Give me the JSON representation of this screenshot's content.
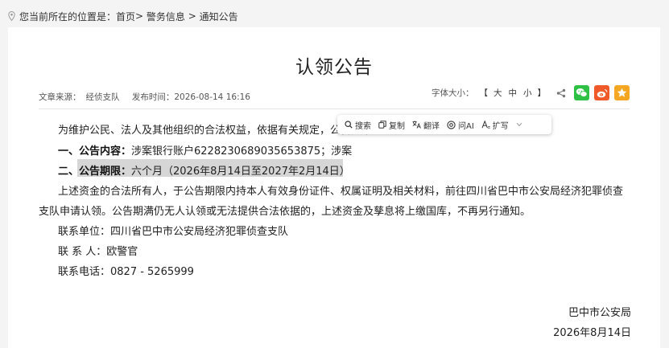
{
  "breadcrumb": {
    "prefix": "您当前所在的位置是：",
    "home": "首页",
    "sep1": "> ",
    "section": "警务信息",
    "sep2": " > ",
    "current": "通知公告"
  },
  "article": {
    "title": "认领公告",
    "source_label": "文章来源：",
    "source": "经侦支队",
    "time_label": "发布时间：",
    "time": "2026-08-14 16:16",
    "font_size_label": "字体大小：",
    "bracket_open": "【",
    "font_large": "大",
    "font_medium": "中",
    "font_small": "小",
    "bracket_close": "】",
    "intro": "为维护公民、法人及其他组织的合法权益，依据有关规定，公告如下。",
    "item1_label": "一、公告内容：",
    "item1_text": "涉案银行账户6228230689035653875；涉案",
    "item2_label": "二、公告期限：",
    "item2_text": "六个月（2026年8月14日至2027年2月14日）",
    "para_line1": "上述资金的合法所有人，于公告期限内持本人有效身份证件、权属证明及相关材料，前往四川省巴中市公安局经济犯罪侦查",
    "para_line2": "支队申请认领。公告期满仍无人认领或无法提供合法依据的，上述资金及孳息将上缴国库，不再另行通知。",
    "contact_unit": "联系单位：四川省巴中市公安局经济犯罪侦查支队",
    "contact_person": "联 系 人：欧警官",
    "contact_phone": "联系电话：0827 - 5265999",
    "sign_org": "巴中市公安局",
    "sign_date": "2026年8月14日"
  },
  "toolbar": {
    "search": "搜索",
    "copy": "复制",
    "translate": "翻译",
    "ask_ai": "问AI",
    "expand": "扩写"
  },
  "colors": {
    "wechat": "#2fc145",
    "weibo": "#f0592a",
    "favorite": "#f5a623",
    "highlight": "#d6d6d6"
  }
}
